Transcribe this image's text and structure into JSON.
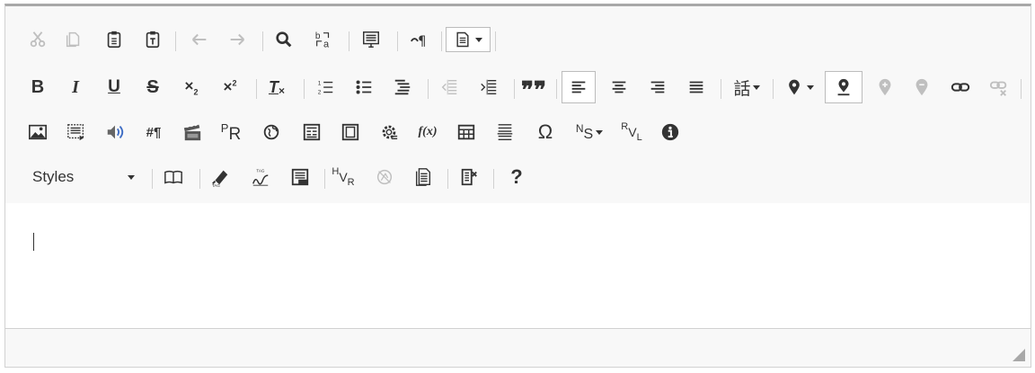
{
  "toolbar": {
    "rows": [
      [
        "cut",
        "copy",
        "paste",
        "paste-text",
        "undo",
        "redo",
        "find",
        "replace",
        "source",
        "show-blocks",
        "templates"
      ],
      [
        "bold",
        "italic",
        "underline",
        "strike",
        "subscript",
        "superscript",
        "remove-format",
        "numbered-list",
        "bulleted-list",
        "indent-list",
        "outdent",
        "indent",
        "blockquote",
        "align-left",
        "align-center",
        "align-right",
        "justify",
        "language",
        "anchor",
        "anchor-mark",
        "bookmark-1",
        "bookmark-2",
        "link",
        "unlink"
      ],
      [
        "image",
        "iframe",
        "audio",
        "special-chars",
        "video",
        "pr",
        "globe",
        "table-form",
        "frame",
        "settings",
        "formula",
        "table",
        "hr",
        "omega",
        "ns",
        "rvl",
        "info"
      ],
      [
        "styles",
        "book",
        "tag-pen",
        "tag-sign",
        "tag-doc",
        "hvr",
        "compass",
        "doc-list",
        "exit",
        "help"
      ]
    ],
    "labels": {
      "pr_sup": "P",
      "pr_sub": "R",
      "ns_sup": "N",
      "ns_sub": "S",
      "rvl_sup": "R",
      "rvl_sub": "V",
      "rvl_sub2": "L",
      "hvr_sup": "H",
      "hvr_sub": "V",
      "hvr_sub2": "R",
      "blockquote": "❞❞",
      "hash_para": "#¶",
      "omega": "Ω",
      "help": "?",
      "fx": "f(x)"
    },
    "styles_combo": {
      "label": "Styles"
    }
  },
  "colors": {
    "toolbar_bg": "#f8f8f8",
    "border": "#d1d1d1",
    "icon": "#333333",
    "disabled": "#bfbfbf"
  }
}
